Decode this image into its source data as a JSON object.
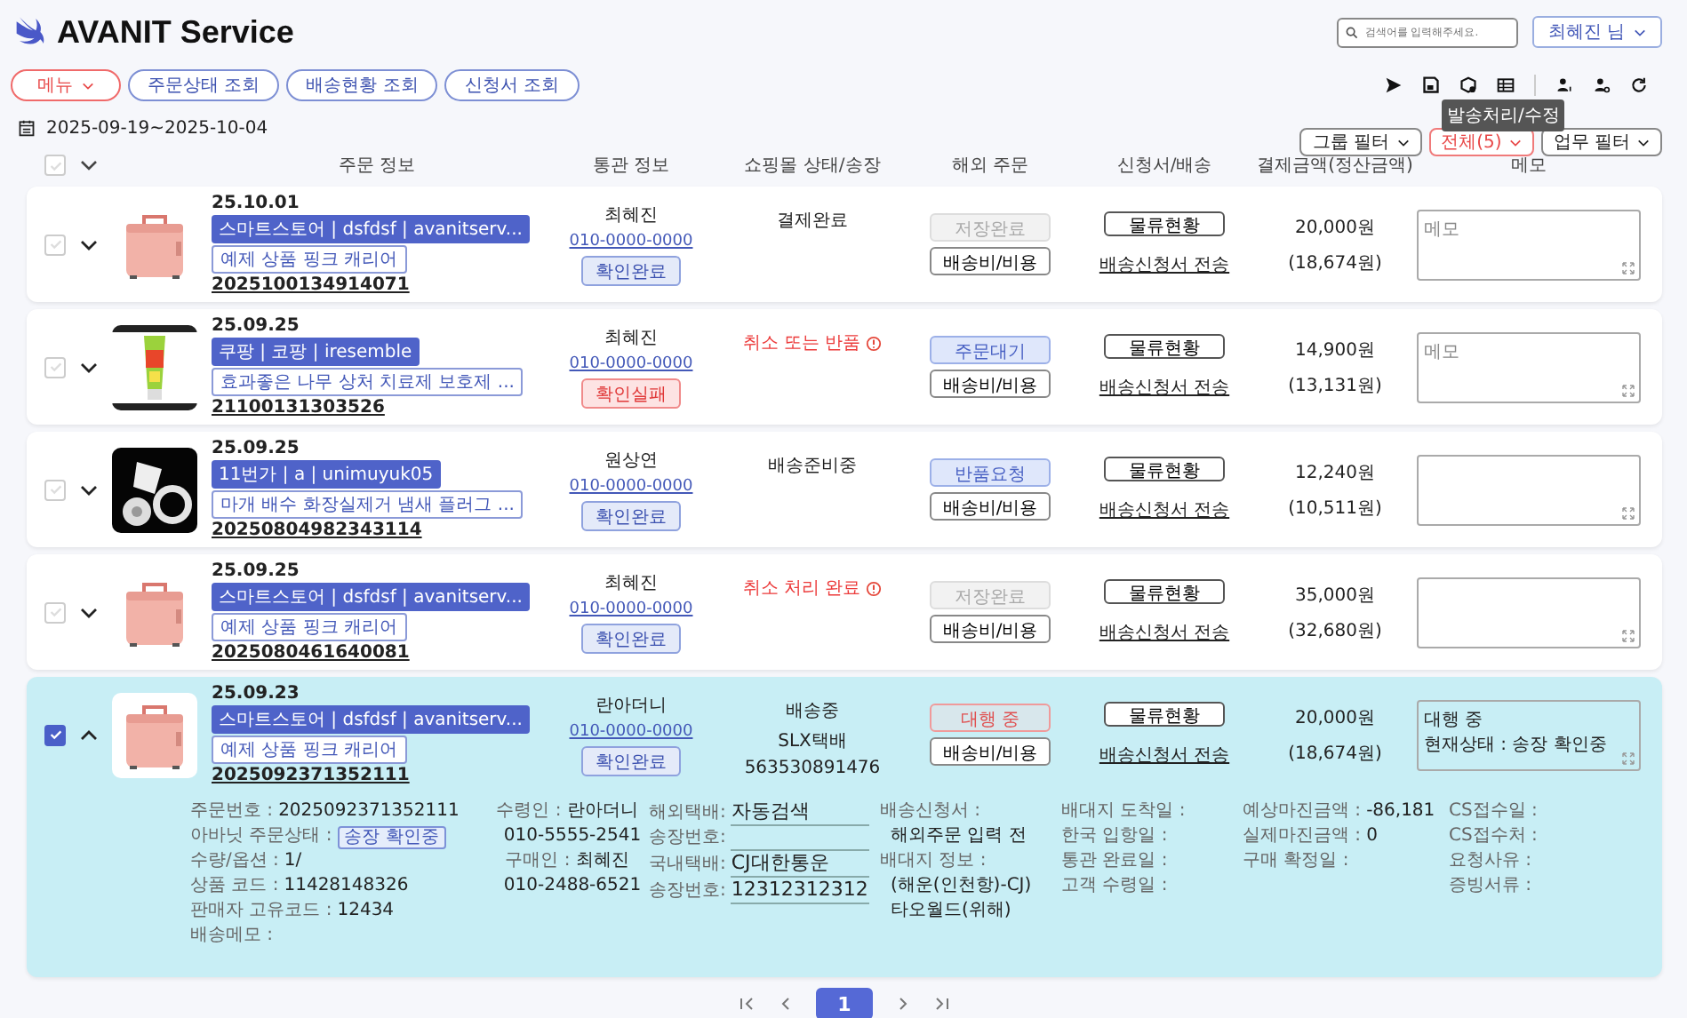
{
  "app": {
    "title": "AVANIT Service"
  },
  "search": {
    "placeholder": "검색어를 입력해주세요."
  },
  "user_menu": {
    "label": "최혜진 님"
  },
  "nav": [
    {
      "label": "메뉴",
      "kind": "menu"
    },
    {
      "label": "주문상태 조회",
      "kind": "link"
    },
    {
      "label": "배송현황 조회",
      "kind": "link"
    },
    {
      "label": "신청서 조회",
      "kind": "link"
    }
  ],
  "date_range": "2025-09-19~2025-10-04",
  "toolbar": {
    "tooltip": "발송처리/수정"
  },
  "filters": [
    {
      "label": "그룹 필터",
      "kind": "plain"
    },
    {
      "label": "전체(5)",
      "kind": "alert"
    },
    {
      "label": "업무 필터",
      "kind": "plain"
    }
  ],
  "all_selected": false,
  "columns": [
    "주문 정보",
    "통관 정보",
    "쇼핑몰 상태/송장",
    "해외 주문",
    "신청서/배송",
    "결제금액(정산금액)",
    "메모"
  ],
  "orders": [
    {
      "selected": false,
      "expanded": false,
      "date": "25.10.01",
      "channel": "스마트스토어 | dsfdsf | avanitserv...",
      "product": "예제 상품 핑크 캐리어",
      "order_no": "2025100134914071",
      "name": "최혜진",
      "phone": "010-0000-0000",
      "customs": {
        "label": "확인완료",
        "kind": "ok"
      },
      "shop": {
        "status": "결제완료",
        "kind": "normal"
      },
      "overseas": {
        "label": "저장완료",
        "kind": "done"
      },
      "cost_button": "배송비/비용",
      "logistics_button": "물류현황",
      "apply_link": "배송신청서 전송",
      "amount": "20,000원",
      "settle": "(18,674원)",
      "memo": {
        "placeholder": "메모"
      }
    },
    {
      "selected": false,
      "expanded": false,
      "date": "25.09.25",
      "channel": "쿠팡 | 코팡 | iresemble",
      "product": "효과좋은 나무 상처 치료제 보호제 ...",
      "order_no": "21100131303526",
      "name": "최혜진",
      "phone": "010-0000-0000",
      "customs": {
        "label": "확인실패",
        "kind": "fail"
      },
      "shop": {
        "status": "취소 또는 반품",
        "kind": "alert"
      },
      "overseas": {
        "label": "주문대기",
        "kind": "waiting"
      },
      "cost_button": "배송비/비용",
      "logistics_button": "물류현황",
      "apply_link": "배송신청서 전송",
      "amount": "14,900원",
      "settle": "(13,131원)",
      "memo": {
        "placeholder": "메모"
      }
    },
    {
      "selected": false,
      "expanded": false,
      "date": "25.09.25",
      "channel": "11번가 | a | unimuyuk05",
      "product": "마개 배수 화장실제거 냄새 플러그 ...",
      "order_no": "20250804982343114",
      "name": "원상연",
      "phone": "010-0000-0000",
      "customs": {
        "label": "확인완료",
        "kind": "ok"
      },
      "shop": {
        "status": "배송준비중",
        "kind": "normal"
      },
      "overseas": {
        "label": "반품요청",
        "kind": "waiting"
      },
      "cost_button": "배송비/비용",
      "logistics_button": "물류현황",
      "apply_link": "배송신청서 전송",
      "amount": "12,240원",
      "settle": "(10,511원)"
    },
    {
      "selected": false,
      "expanded": false,
      "date": "25.09.25",
      "channel": "스마트스토어 | dsfdsf | avanitserv...",
      "product": "예제 상품 핑크 캐리어",
      "order_no": "2025080461640081",
      "name": "최혜진",
      "phone": "010-0000-0000",
      "customs": {
        "label": "확인완료",
        "kind": "ok"
      },
      "shop": {
        "status": "취소 처리 완료",
        "kind": "alert"
      },
      "overseas": {
        "label": "저장완료",
        "kind": "done"
      },
      "cost_button": "배송비/비용",
      "logistics_button": "물류현황",
      "apply_link": "배송신청서 전송",
      "amount": "35,000원",
      "settle": "(32,680원)"
    },
    {
      "selected": true,
      "expanded": true,
      "date": "25.09.23",
      "channel": "스마트스토어 | dsfdsf | avanitserv...",
      "product": "예제 상품 핑크 캐리어",
      "order_no": "2025092371352111",
      "name": "란아더니",
      "phone": "010-0000-0000",
      "customs": {
        "label": "확인완료",
        "kind": "ok"
      },
      "shop": {
        "status": "배송중",
        "kind": "normal",
        "courier": "SLX택배",
        "tracking": "563530891476"
      },
      "overseas": {
        "label": "대행 중",
        "kind": "warn"
      },
      "cost_button": "배송비/비용",
      "logistics_button": "물류현황",
      "apply_link": "배송신청서 전송",
      "amount": "20,000원",
      "settle": "(18,674원)",
      "memo": {
        "value": "대행 중\n현재상태 : 송장 확인중"
      },
      "details": [
        {
          "kind": "text",
          "items": [
            {
              "label": "주문번호 :",
              "value": "2025092371352111"
            },
            {
              "label": "아바닛 주문상태 :",
              "badge": "송장 확인중"
            },
            {
              "label": "수량/옵션 :",
              "value": "1/"
            },
            {
              "label": "상품 코드 :",
              "value": "11428148326"
            },
            {
              "label": "판매자 고유코드 :",
              "value": "12434"
            },
            {
              "label": "배송메모 :"
            }
          ]
        },
        {
          "kind": "center",
          "items": [
            {
              "label": "수령인 :",
              "value": "란아더니"
            },
            {
              "value": "010-5555-2541"
            },
            {
              "label": "구매인 :",
              "value": "최혜진"
            },
            {
              "value": "010-2488-6521"
            }
          ]
        },
        {
          "kind": "input",
          "items": [
            {
              "label": "해외택배:",
              "value": "자동검색"
            },
            {
              "label": "송장번호:"
            },
            {
              "label": "국내택배:",
              "value": "CJ대한통운"
            },
            {
              "label": "송장번호:",
              "value": "12312312312"
            }
          ]
        },
        {
          "kind": "text",
          "items": [
            {
              "label": "배송신청서 :"
            },
            {
              "value": "해외주문 입력 전"
            },
            {
              "label": "배대지 정보 :"
            },
            {
              "value": "(해운(인천항)-CJ)"
            },
            {
              "value": "타오월드(위해)"
            }
          ]
        },
        {
          "kind": "text",
          "items": [
            {
              "label": "배대지 도착일 :"
            },
            {
              "label": "한국 입항일 :"
            },
            {
              "label": "통관 완료일 :"
            },
            {
              "label": "고객 수령일 :"
            }
          ]
        },
        {
          "kind": "text",
          "items": [
            {
              "label": "예상마진금액 :",
              "value": "-86,181"
            },
            {
              "label": "실제마진금액 :",
              "value": "0"
            },
            {
              "label": "구매 확정일 :"
            }
          ]
        },
        {
          "kind": "text",
          "items": [
            {
              "label": "CS접수일 :"
            },
            {
              "label": "CS접수처 :"
            },
            {
              "label": "요청사유 :"
            },
            {
              "label": "증빙서류 :"
            }
          ]
        }
      ]
    }
  ],
  "pagination": {
    "pages": [
      {
        "label": "1",
        "selected": true
      }
    ]
  }
}
